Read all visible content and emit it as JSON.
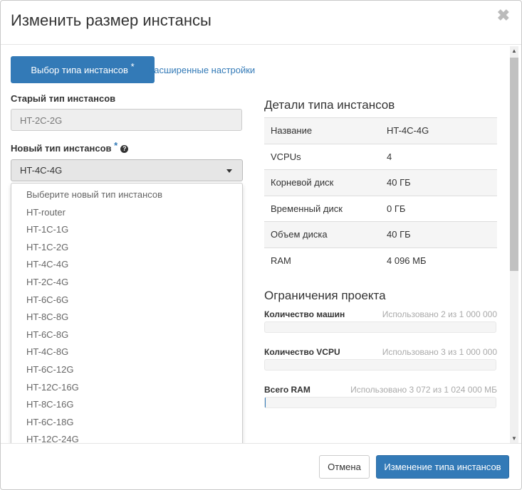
{
  "modal": {
    "title": "Изменить размер инстансы",
    "close_glyph": "✖"
  },
  "tabs": {
    "active_label": "Выбор типа инстансов",
    "active_required": "*",
    "link_label": "Расширенные настройки"
  },
  "old_flavor": {
    "label": "Старый тип инстансов",
    "value": "HT-2C-2G"
  },
  "new_flavor": {
    "label": "Новый тип инстансов",
    "required": "*",
    "help_glyph": "?",
    "selected": "HT-4C-4G",
    "options": [
      "Выберите новый тип инстансов",
      "HT-router",
      "HT-1C-1G",
      "HT-1C-2G",
      "HT-4C-4G",
      "HT-2C-4G",
      "HT-6C-6G",
      "HT-8C-8G",
      "HT-6C-8G",
      "HT-4C-8G",
      "HT-6C-12G",
      "HT-12C-16G",
      "HT-8C-16G",
      "HT-6C-18G",
      "HT-12C-24G"
    ]
  },
  "details": {
    "title": "Детали типа инстансов",
    "rows": [
      {
        "name": "Название",
        "value": "HT-4C-4G"
      },
      {
        "name": "VCPUs",
        "value": "4"
      },
      {
        "name": "Корневой диск",
        "value": "40 ГБ"
      },
      {
        "name": "Временный диск",
        "value": "0 ГБ"
      },
      {
        "name": "Объем диска",
        "value": "40 ГБ"
      },
      {
        "name": "RAM",
        "value": "4 096 МБ"
      }
    ]
  },
  "limits": {
    "title": "Ограничения проекта",
    "items": [
      {
        "name": "Количество машин",
        "used": "Использовано 2 из 1 000 000",
        "fraction": 2e-06
      },
      {
        "name": "Количество VCPU",
        "used": "Использовано 3 из 1 000 000",
        "fraction": 3e-06
      },
      {
        "name": "Всего RAM",
        "used": "Использовано 3 072 из 1 024 000 МБ",
        "fraction": 0.003
      }
    ]
  },
  "footer": {
    "cancel_label": "Отмена",
    "submit_label": "Изменение типа инстансов"
  },
  "colors": {
    "primary": "#337ab7"
  }
}
